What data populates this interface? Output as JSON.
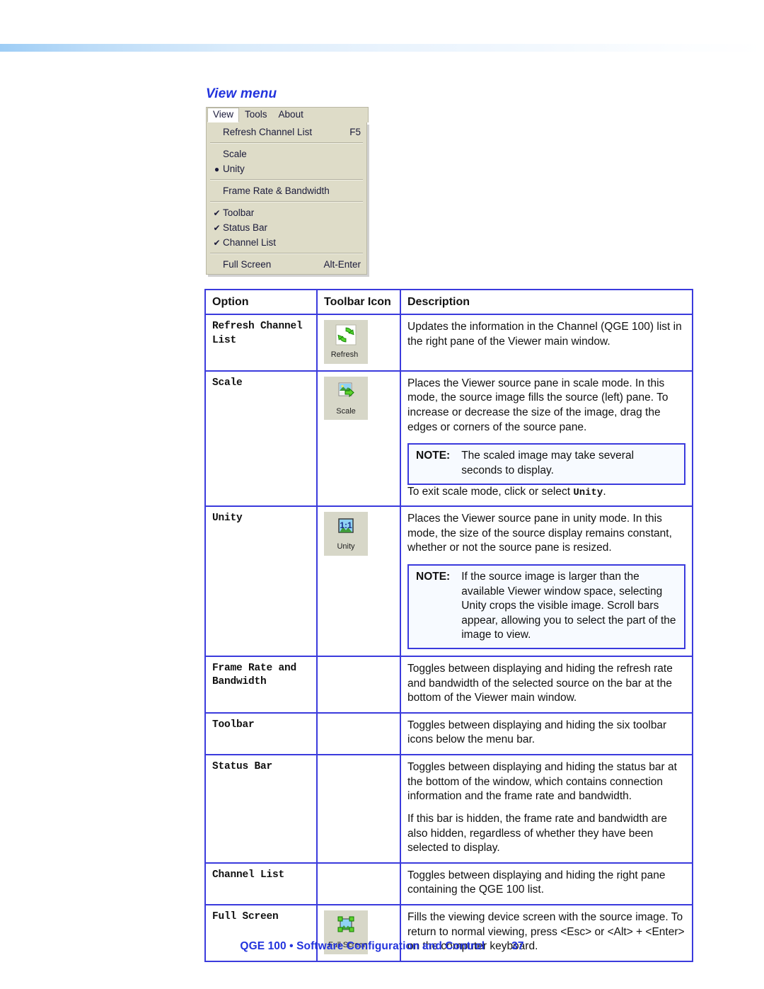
{
  "section": {
    "heading": "View menu"
  },
  "menu_screenshot": {
    "menubar": [
      {
        "label": "View",
        "active": true
      },
      {
        "label": "Tools",
        "active": false
      },
      {
        "label": "About",
        "active": false
      }
    ],
    "items": [
      {
        "mark": "",
        "label": "Refresh Channel List",
        "accel": "F5"
      },
      {
        "separator": true
      },
      {
        "mark": "",
        "label": "Scale",
        "accel": ""
      },
      {
        "mark": "●",
        "label": "Unity",
        "accel": ""
      },
      {
        "separator": true
      },
      {
        "mark": "",
        "label": "Frame Rate & Bandwidth",
        "accel": ""
      },
      {
        "separator": true
      },
      {
        "mark": "✔",
        "label": "Toolbar",
        "accel": ""
      },
      {
        "mark": "✔",
        "label": "Status Bar",
        "accel": ""
      },
      {
        "mark": "✔",
        "label": "Channel List",
        "accel": ""
      },
      {
        "separator": true
      },
      {
        "mark": "",
        "label": "Full Screen",
        "accel": "Alt-Enter"
      }
    ]
  },
  "table": {
    "headers": {
      "option": "Option",
      "icon": "Toolbar Icon",
      "description": "Description"
    },
    "rows": [
      {
        "option": "Refresh Channel List",
        "icon": {
          "name": "refresh-icon",
          "caption": "Refresh",
          "underline": true
        },
        "paragraphs": [
          "Updates the information in the Channel (QGE 100) list in the right pane of the Viewer main window."
        ],
        "notes": []
      },
      {
        "option": "Scale",
        "icon": {
          "name": "scale-icon",
          "caption": "Scale",
          "underline": false
        },
        "paragraphs": [
          "Places the Viewer source pane in scale mode. In this mode, the source image fills the source (left) pane. To increase or decrease the size of the image, drag the edges or corners of the source pane."
        ],
        "notes": [
          {
            "label": "NOTE:",
            "text": "The scaled image may take several seconds to display.",
            "after_index": 0
          }
        ],
        "trailing_paragraph_prefix": "To exit scale mode, click or select ",
        "trailing_paragraph_mono": "Unity",
        "trailing_paragraph_suffix": "."
      },
      {
        "option": "Unity",
        "icon": {
          "name": "unity-icon",
          "caption": "Unity",
          "underline": false
        },
        "paragraphs": [
          "Places the Viewer source pane in unity mode. In this mode, the size of the source display remains constant, whether or not the source pane is resized."
        ],
        "notes": [
          {
            "label": "NOTE:",
            "text": "If the source image is larger than the available Viewer window space, selecting Unity crops the visible image. Scroll bars appear, allowing you to select the part of the image to view.",
            "after_index": 0
          }
        ]
      },
      {
        "option": "Frame Rate and Bandwidth",
        "icon": null,
        "paragraphs": [
          "Toggles between displaying and hiding the refresh rate and bandwidth of the selected source on the bar at the bottom of the Viewer main window."
        ],
        "notes": []
      },
      {
        "option": "Toolbar",
        "icon": null,
        "paragraphs": [
          "Toggles between displaying and hiding the six toolbar icons below the menu bar."
        ],
        "notes": []
      },
      {
        "option": "Status Bar",
        "icon": null,
        "paragraphs": [
          "Toggles between displaying and hiding the status bar at the bottom of the window, which contains connection information and the frame rate and bandwidth.",
          "If this bar is hidden, the frame rate and bandwidth are also hidden, regardless of whether they have been selected to display."
        ],
        "notes": []
      },
      {
        "option": "Channel List",
        "icon": null,
        "paragraphs": [
          "Toggles between displaying and hiding the right pane containing the QGE 100 list."
        ],
        "notes": []
      },
      {
        "option": "Full Screen",
        "icon": {
          "name": "full-screen-icon",
          "caption": "Full Screen",
          "underline": false
        },
        "paragraphs": [
          "Fills the viewing device screen with the source image. To return to normal viewing, press <Esc> or <Alt> + <Enter> on the computer keyboard."
        ],
        "notes": []
      }
    ]
  },
  "footer": {
    "text": "QGE 100 • Software Configuration and Control",
    "page_number": "37"
  },
  "colors": {
    "accent_blue": "#2233dd",
    "table_border": "#3b3bdd",
    "note_bg": "#f7faff",
    "menu_bg": "#dedcc8",
    "toolbar_btn_bg": "#d7d7c8",
    "icon_green": "#3fbe28"
  }
}
